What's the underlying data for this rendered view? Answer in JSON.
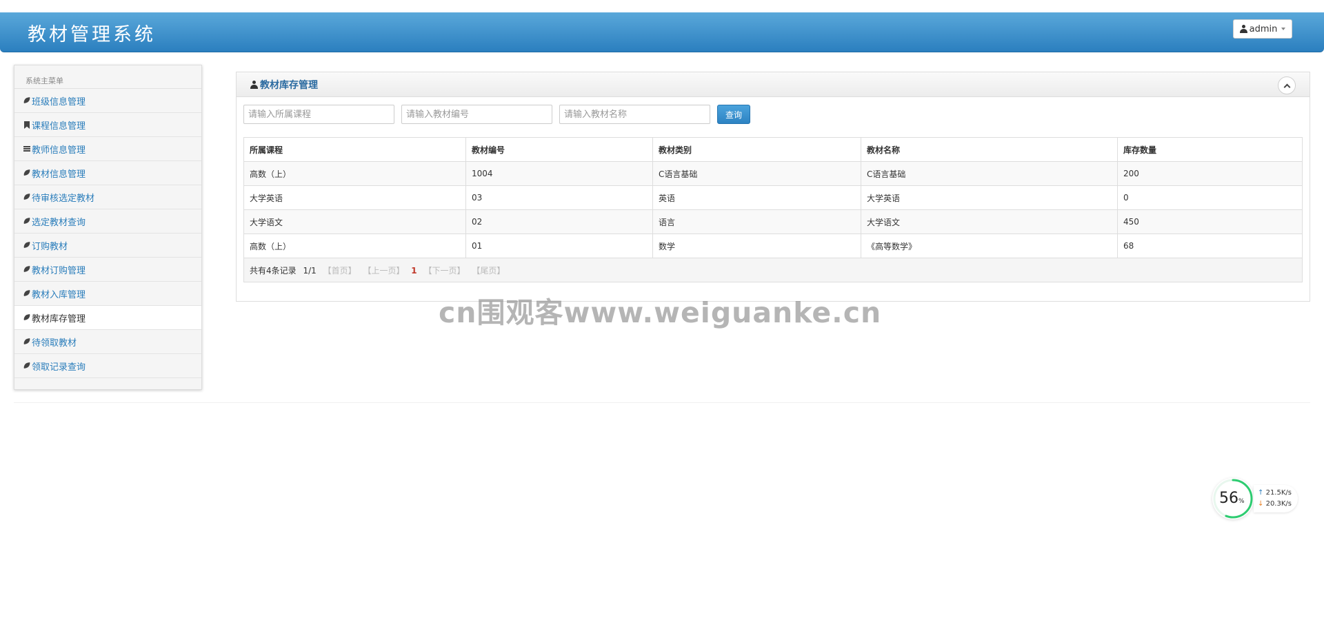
{
  "header": {
    "title": "教材管理系统",
    "user_label": "admin"
  },
  "sidebar": {
    "heading": "系统主菜单",
    "items": [
      {
        "label": "班级信息管理",
        "icon": "leaf-icon"
      },
      {
        "label": "课程信息管理",
        "icon": "bookmark-icon"
      },
      {
        "label": "教师信息管理",
        "icon": "list-icon"
      },
      {
        "label": "教材信息管理",
        "icon": "leaf-icon"
      },
      {
        "label": "待审核选定教材",
        "icon": "leaf-icon"
      },
      {
        "label": "选定教材查询",
        "icon": "leaf-icon"
      },
      {
        "label": "订购教材",
        "icon": "leaf-icon"
      },
      {
        "label": "教材订购管理",
        "icon": "leaf-icon"
      },
      {
        "label": "教材入库管理",
        "icon": "leaf-icon"
      },
      {
        "label": "教材库存管理",
        "icon": "leaf-icon",
        "active": true
      },
      {
        "label": "待领取教材",
        "icon": "leaf-icon"
      },
      {
        "label": "领取记录查询",
        "icon": "leaf-icon"
      }
    ]
  },
  "panel": {
    "title": "教材库存管理",
    "search": {
      "course_placeholder": "请输入所属课程",
      "code_placeholder": "请输入教材编号",
      "name_placeholder": "请输入教材名称",
      "button_label": "查询"
    },
    "table": {
      "columns": [
        "所属课程",
        "教材编号",
        "教材类别",
        "教材名称",
        "库存数量"
      ],
      "rows": [
        [
          "高数（上）",
          "1004",
          "C语言基础",
          "C语言基础",
          "200"
        ],
        [
          "大学英语",
          "03",
          "英语",
          "大学英语",
          "0"
        ],
        [
          "大学语文",
          "02",
          "语言",
          "大学语文",
          "450"
        ],
        [
          "高数（上）",
          "01",
          "数学",
          "《高等数学》",
          "68"
        ]
      ]
    },
    "pager": {
      "summary": "共有4条记录",
      "page_info": "1/1",
      "first": "【首页】",
      "prev": "【上一页】",
      "current": "1",
      "next": "【下一页】",
      "last": "【尾页】"
    }
  },
  "watermark": "cn围观客www.weiguanke.cn",
  "speed_widget": {
    "percent": "56",
    "percent_unit": "%",
    "up_rate": "21.5K/s",
    "down_rate": "20.3K/s",
    "ring_color": "#2ecc71"
  }
}
